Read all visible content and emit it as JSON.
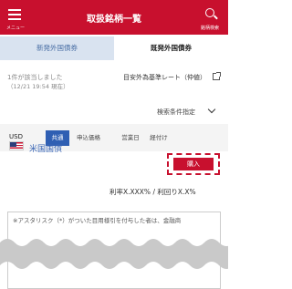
{
  "header": {
    "title": "取扱銘柄一覧",
    "menu_caption": "メニュー",
    "search_caption": "銘柄検索"
  },
  "tabs": {
    "new": "新発外国債券",
    "issued": "既発外国債券"
  },
  "summary": {
    "count": "1件が該当しました",
    "as_of": "（12/21 19:54 現在）",
    "rate_link": "目安外為基準レート（仲値）"
  },
  "filter": {
    "label": "検索条件指定"
  },
  "sort": {
    "all": "共通",
    "price": "申込価格",
    "date": "営業日",
    "time": "経付け"
  },
  "bond": {
    "currency": "USD",
    "name": "米国国債",
    "buy_label": "購入",
    "coupon": "利率X.XXX%",
    "yield": "利回りX.X%"
  },
  "note": {
    "text": "※アスタリスク（*）がついた目用様引を付与した者は、金融商"
  }
}
